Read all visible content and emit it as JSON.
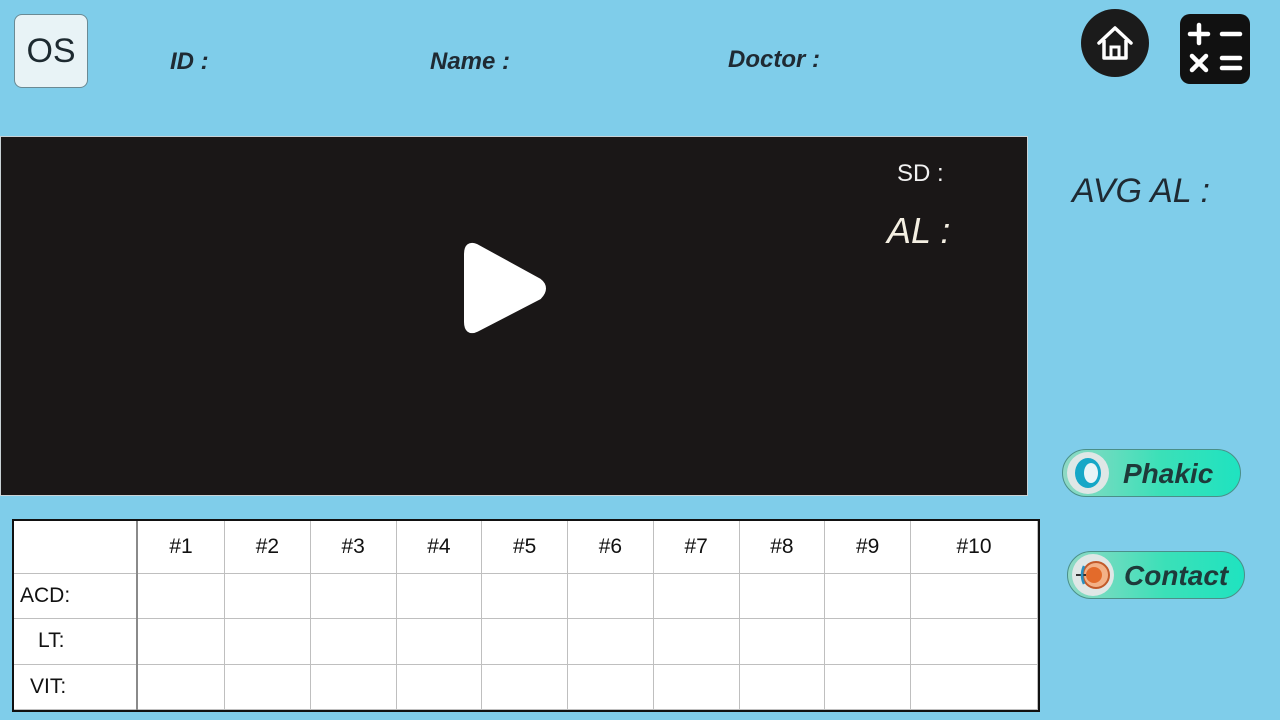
{
  "header": {
    "eye_label": "OS",
    "id_label": "ID :",
    "name_label": "Name :",
    "doctor_label": "Doctor :"
  },
  "toolbar": {
    "home_icon": "home-icon",
    "calculator_icon": "calculator-icon"
  },
  "video": {
    "sd_label": "SD :",
    "al_label": "AL :"
  },
  "side": {
    "avg_al_label": "AVG AL :",
    "phakic_label": "Phakic",
    "contact_label": "Contact"
  },
  "table": {
    "columns": [
      "#1",
      "#2",
      "#3",
      "#4",
      "#5",
      "#6",
      "#7",
      "#8",
      "#9",
      "#10"
    ],
    "rows": [
      "ACD:",
      "LT:",
      "VIT:"
    ]
  }
}
